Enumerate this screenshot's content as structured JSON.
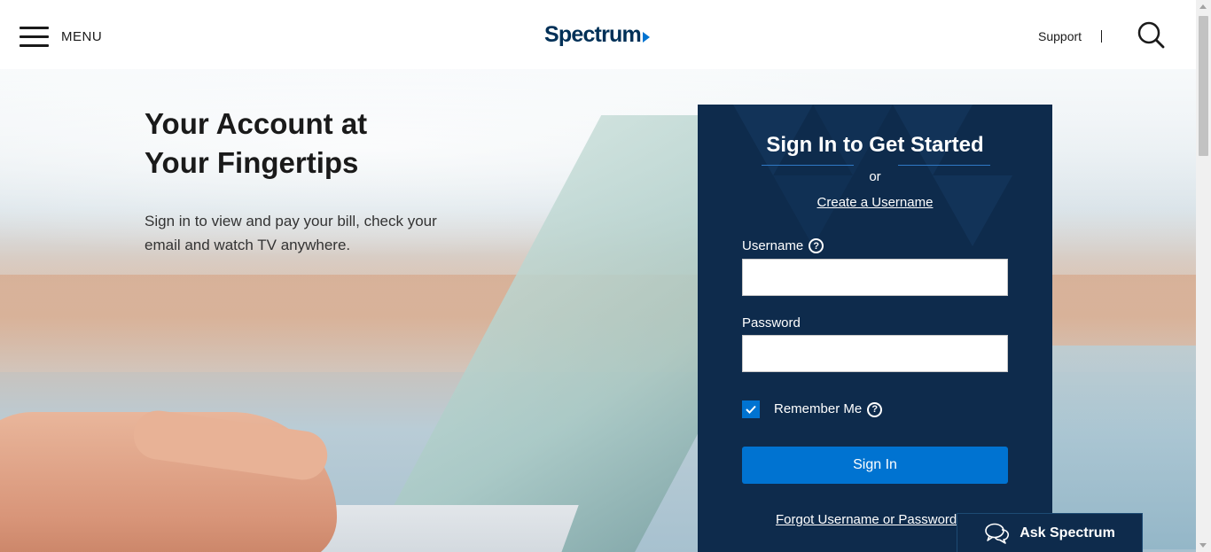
{
  "header": {
    "menu_label": "MENU",
    "logo_text": "Spectrum",
    "support_label": "Support",
    "icons": {
      "menu": "hamburger-icon",
      "search": "search-icon"
    }
  },
  "hero": {
    "title_line1": "Your Account at",
    "title_line2": "Your Fingertips",
    "description": "Sign in to view and pay your bill, check your email and watch TV anywhere."
  },
  "signin": {
    "title": "Sign In to Get Started",
    "or_text": "or",
    "create_link": "Create a Username",
    "username_label": "Username",
    "username_value": "",
    "password_label": "Password",
    "password_value": "",
    "remember_label": "Remember Me",
    "remember_checked": true,
    "signin_button": "Sign In",
    "forgot_link": "Forgot Username or Password?"
  },
  "chat": {
    "label": "Ask Spectrum",
    "icon": "chat-bubbles-icon"
  },
  "colors": {
    "panel_bg": "#0e2b4c",
    "accent_blue": "#0073d1",
    "logo_navy": "#003057",
    "text_dark": "#1a1a1a"
  }
}
